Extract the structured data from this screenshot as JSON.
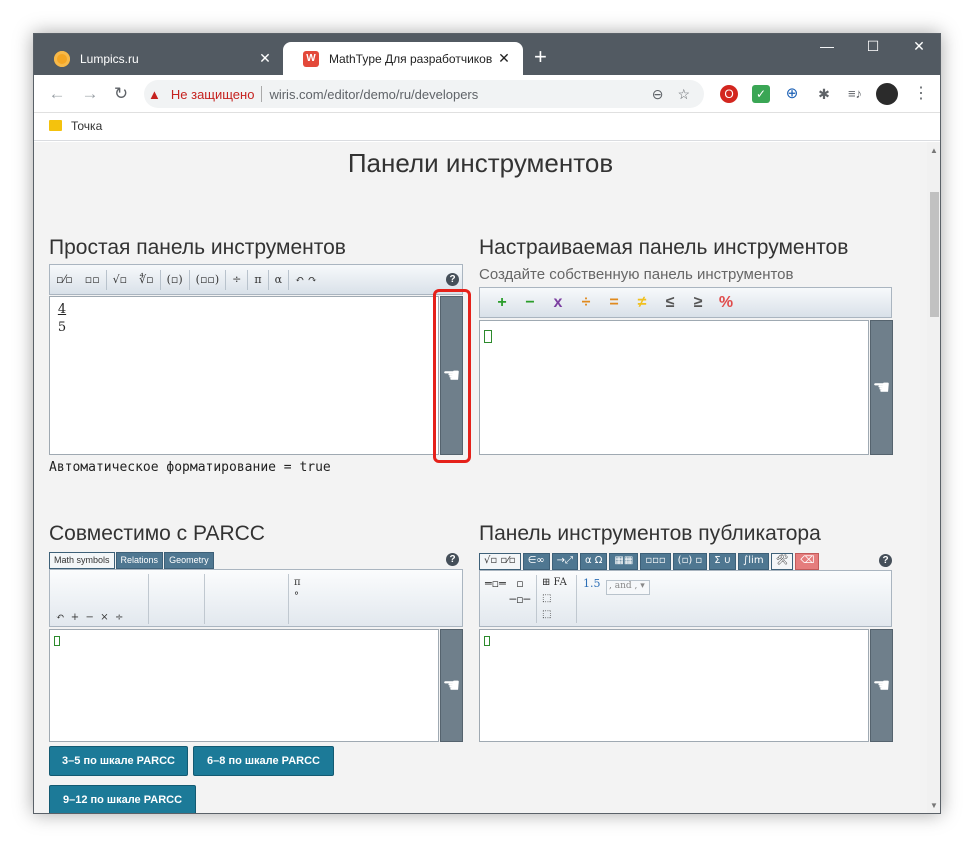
{
  "browser": {
    "tabs": [
      {
        "title": "Lumpics.ru",
        "close": "✕"
      },
      {
        "title": "MathType Для разработчиков (",
        "close": "✕",
        "favicon_text": "W"
      }
    ],
    "new_tab": "+",
    "window_controls": {
      "minimize": "—",
      "maximize": "☐",
      "close": "✕"
    },
    "nav": {
      "back": "←",
      "forward": "→",
      "reload": "↻"
    },
    "address": {
      "warning": "Не защищено",
      "url": "wiris.com/editor/demo/ru/developers"
    },
    "bookmarks": [
      {
        "label": "Точка"
      }
    ]
  },
  "page": {
    "title": "Панели инструментов",
    "simple": {
      "title": "Простая панель инструментов",
      "toolbar": [
        "▫⁄▫",
        "▫▫",
        "√▫",
        "∜▫",
        "(▫)",
        "(▫▫)",
        "÷",
        "π",
        "α",
        "↶ ↷"
      ],
      "formula_num": "4",
      "formula_den": "5",
      "status": "Автоматическое форматирование = true"
    },
    "custom": {
      "title": "Настраиваемая панель инструментов",
      "subtitle": "Создайте собственную панель инструментов",
      "toolbar": [
        {
          "sym": "+",
          "color": "#2a9d2a"
        },
        {
          "sym": "−",
          "color": "#2a9d2a"
        },
        {
          "sym": "x",
          "color": "#7b3fa0"
        },
        {
          "sym": "÷",
          "color": "#e08a1e"
        },
        {
          "sym": "=",
          "color": "#e08a1e"
        },
        {
          "sym": "≠",
          "color": "#f0c020"
        },
        {
          "sym": "≤",
          "color": "#555555"
        },
        {
          "sym": "≥",
          "color": "#555555"
        },
        {
          "sym": "%",
          "color": "#e04a4a"
        }
      ]
    },
    "parcc": {
      "title": "Совместимо с PARCC",
      "tabs": [
        "Math symbols",
        "Relations",
        "Geometry"
      ],
      "row1": "↶  +  −  ×  ÷",
      "row2": "↷  =  ≠  ±  ‾",
      "row3": "▯  ·  /  %",
      "group2": [
        "√▫  ▫▫",
        "∛▫"
      ],
      "group3": [
        "▫⁄▫  (▫)  [▫]",
        "▫▫   |▫|"
      ],
      "group4": [
        "π",
        "°"
      ],
      "buttons": [
        "3–5 по шкале PARCC",
        "6–8 по шкале PARCC",
        "9–12 по шкале PARCC"
      ]
    },
    "publisher": {
      "title": "Панель инструментов публикатора",
      "tabs": [
        "√▫ ▫⁄▫",
        "∈∞",
        "→⤢",
        "α Ω",
        "▦▦",
        "▫▫▫",
        "(▫) ▫",
        "Σ ∪",
        "∫lim",
        "🛠",
        "⌫"
      ],
      "font_size": "1.5",
      "font_select": ", and , ▾"
    }
  }
}
